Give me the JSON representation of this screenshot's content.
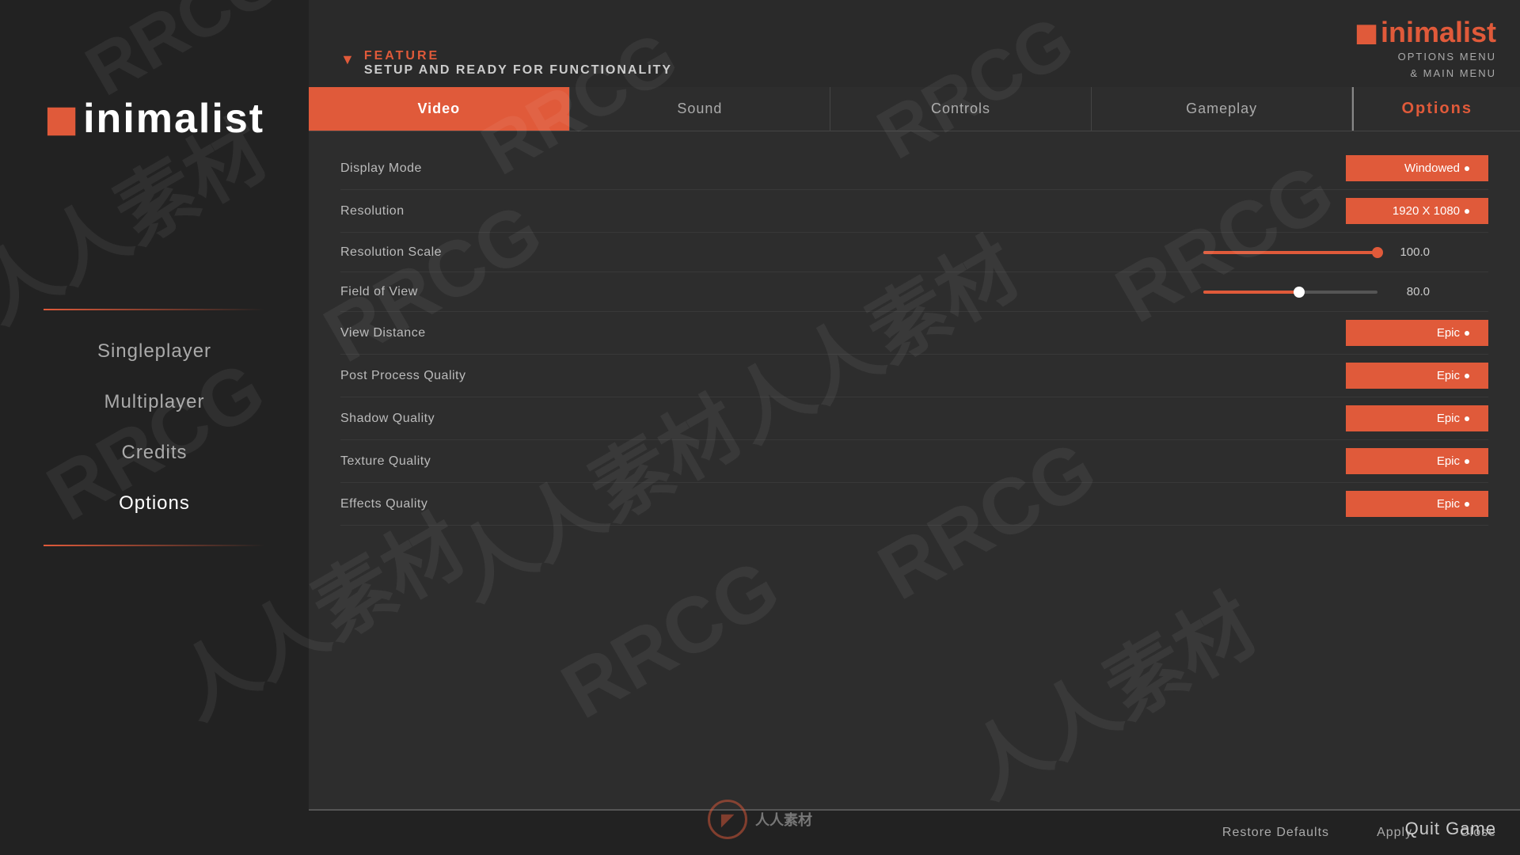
{
  "brand": {
    "logo_prefix": "M",
    "logo_text": "inimalist",
    "subtitle_line1": "OPTIONS MENU",
    "subtitle_line2": "& MAIN MENU"
  },
  "feature": {
    "label": "FEATURE",
    "description": "SETUP AND READY FOR FUNCTIONALITY"
  },
  "sidebar": {
    "logo_prefix": "M",
    "logo_text": "inimalist",
    "items": [
      {
        "id": "singleplayer",
        "label": "Singleplayer"
      },
      {
        "id": "multiplayer",
        "label": "Multiplayer"
      },
      {
        "id": "credits",
        "label": "Credits"
      },
      {
        "id": "options",
        "label": "Options"
      }
    ]
  },
  "tabs": [
    {
      "id": "video",
      "label": "Video",
      "active": true
    },
    {
      "id": "sound",
      "label": "Sound",
      "active": false
    },
    {
      "id": "controls",
      "label": "Controls",
      "active": false
    },
    {
      "id": "gameplay",
      "label": "Gameplay",
      "active": false
    }
  ],
  "options_label": "Options",
  "settings": [
    {
      "id": "display-mode",
      "label": "Display Mode",
      "type": "button",
      "value": "Windowed"
    },
    {
      "id": "resolution",
      "label": "Resolution",
      "type": "button",
      "value": "1920 X 1080"
    },
    {
      "id": "resolution-scale",
      "label": "Resolution Scale",
      "type": "slider",
      "value": "100.0",
      "fill_pct": 100
    },
    {
      "id": "field-of-view",
      "label": "Field of View",
      "type": "slider",
      "value": "80.0",
      "fill_pct": 55
    },
    {
      "id": "view-distance",
      "label": "View Distance",
      "type": "button",
      "value": "Epic"
    },
    {
      "id": "post-process-quality",
      "label": "Post Process Quality",
      "type": "button",
      "value": "Epic"
    },
    {
      "id": "shadow-quality",
      "label": "Shadow Quality",
      "type": "button",
      "value": "Epic"
    },
    {
      "id": "texture-quality",
      "label": "Texture Quality",
      "type": "button",
      "value": "Epic"
    },
    {
      "id": "effects-quality",
      "label": "Effects Quality",
      "type": "button",
      "value": "Epic"
    }
  ],
  "bottom_buttons": [
    {
      "id": "restore-defaults",
      "label": "Restore Defaults"
    },
    {
      "id": "apply",
      "label": "Apply"
    },
    {
      "id": "close",
      "label": "Close"
    }
  ],
  "quit_label": "Quit Game",
  "watermarks": {
    "rrcg": "RRCG",
    "chinese1": "人人素材",
    "chinese2": "人人素材"
  }
}
